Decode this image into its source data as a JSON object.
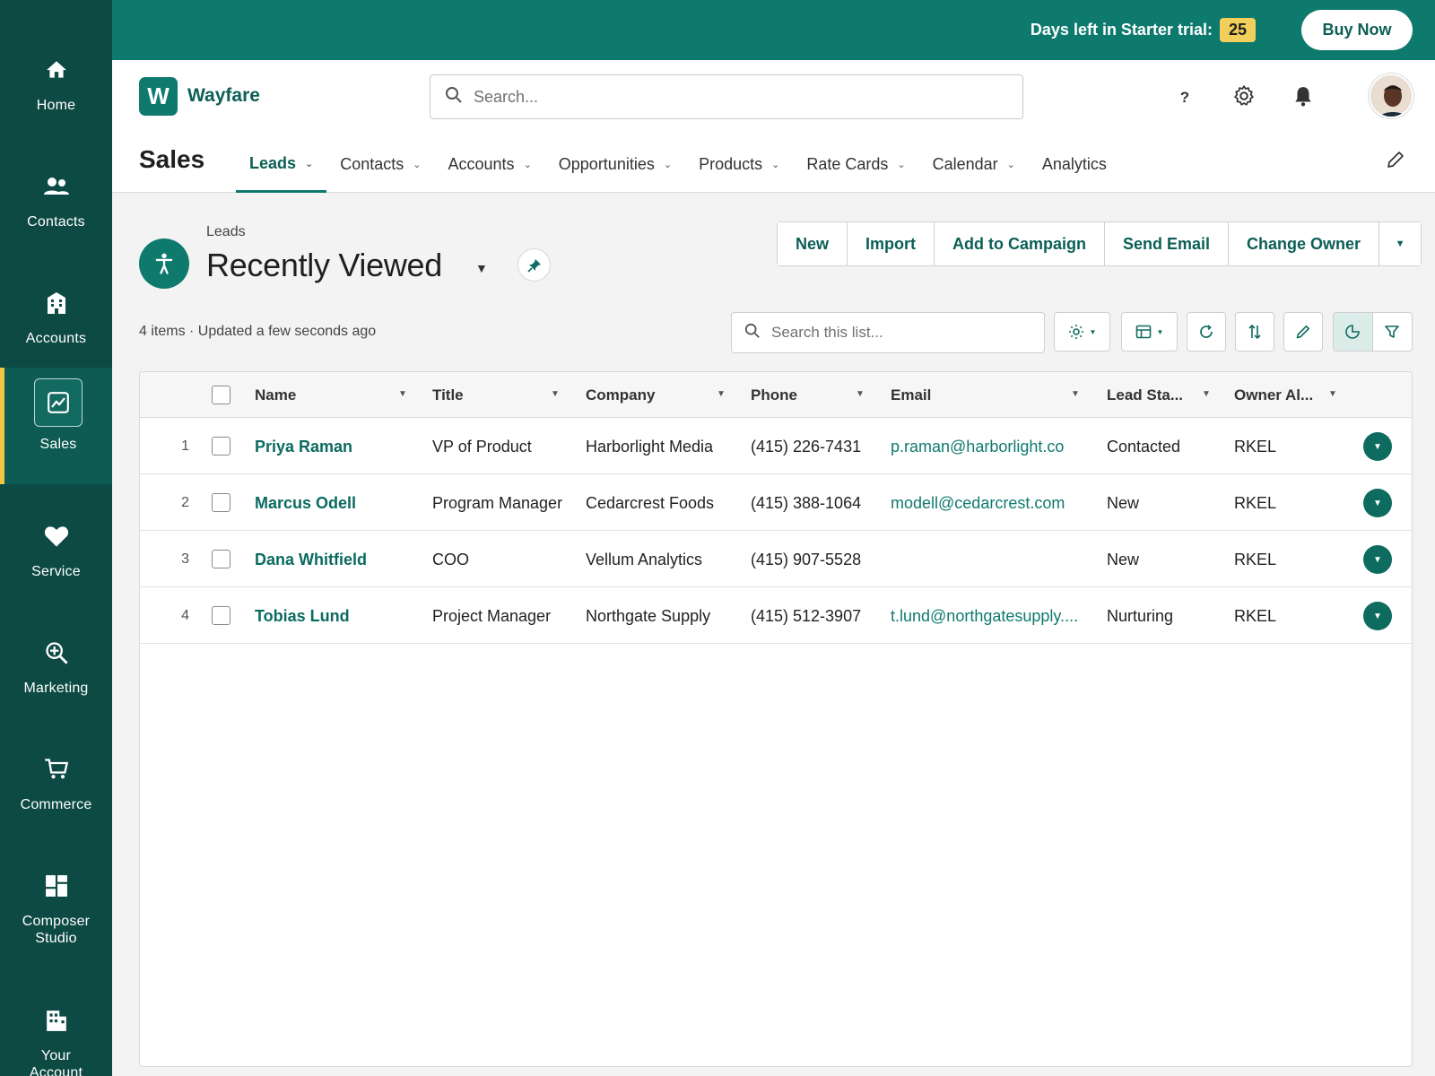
{
  "sidebar": {
    "items": [
      {
        "label": "Home",
        "icon": "home-icon"
      },
      {
        "label": "Contacts",
        "icon": "people-icon"
      },
      {
        "label": "Accounts",
        "icon": "building-icon"
      },
      {
        "label": "Sales",
        "icon": "chart-icon",
        "active": true
      },
      {
        "label": "Service",
        "icon": "heart-icon"
      },
      {
        "label": "Marketing",
        "icon": "magnify-plus-icon"
      },
      {
        "label": "Commerce",
        "icon": "cart-icon"
      },
      {
        "label": "Composer Studio",
        "icon": "grid-icon"
      },
      {
        "label": "Your Account",
        "icon": "office-icon"
      }
    ]
  },
  "topbar": {
    "trial_text": "Days left in Starter trial:",
    "trial_days": "25",
    "buy_label": "Buy Now"
  },
  "header": {
    "logo_letter": "W",
    "brand": "Wayfare",
    "search_placeholder": "Search...",
    "help_label": "?",
    "app_name": "Sales",
    "tabs": [
      {
        "label": "Leads",
        "active": true,
        "dropdown": true
      },
      {
        "label": "Contacts",
        "dropdown": true
      },
      {
        "label": "Accounts",
        "dropdown": true
      },
      {
        "label": "Opportunities",
        "dropdown": true
      },
      {
        "label": "Products",
        "dropdown": true
      },
      {
        "label": "Rate Cards",
        "dropdown": true
      },
      {
        "label": "Calendar",
        "dropdown": true
      },
      {
        "label": "Analytics",
        "dropdown": false
      }
    ]
  },
  "list": {
    "breadcrumb": "Leads",
    "title": "Recently Viewed",
    "count_text": "4 items · Updated a few seconds ago",
    "actions": [
      "New",
      "Import",
      "Add to Campaign",
      "Send Email",
      "Change Owner"
    ],
    "search_placeholder": "Search this list..."
  },
  "table": {
    "columns": [
      "Name",
      "Title",
      "Company",
      "Phone",
      "Email",
      "Lead Sta...",
      "Owner Al..."
    ],
    "rows": [
      {
        "num": "1",
        "name": "Priya Raman",
        "title": "VP of Product",
        "company": "Harborlight Media",
        "phone": "(415) 226-7431",
        "email": "p.raman@harborlight.co",
        "status": "Contacted",
        "owner": "RKEL"
      },
      {
        "num": "2",
        "name": "Marcus Odell",
        "title": "Program Manager",
        "company": "Cedarcrest Foods",
        "phone": "(415) 388-1064",
        "email": "modell@cedarcrest.com",
        "status": "New",
        "owner": "RKEL"
      },
      {
        "num": "3",
        "name": "Dana Whitfield",
        "title": "COO",
        "company": "Vellum Analytics",
        "phone": "(415) 907-5528",
        "email": "",
        "status": "New",
        "owner": "RKEL"
      },
      {
        "num": "4",
        "name": "Tobias Lund",
        "title": "Project Manager",
        "company": "Northgate Supply",
        "phone": "(415) 512-3907",
        "email": "t.lund@northgatesupply....",
        "status": "Nurturing",
        "owner": "RKEL"
      }
    ]
  },
  "colors": {
    "sidebar_bg": "#0d4a44",
    "topbar_bg": "#0e7a6e",
    "accent": "#0b6b60",
    "trial_badge": "#f2cf5b"
  }
}
